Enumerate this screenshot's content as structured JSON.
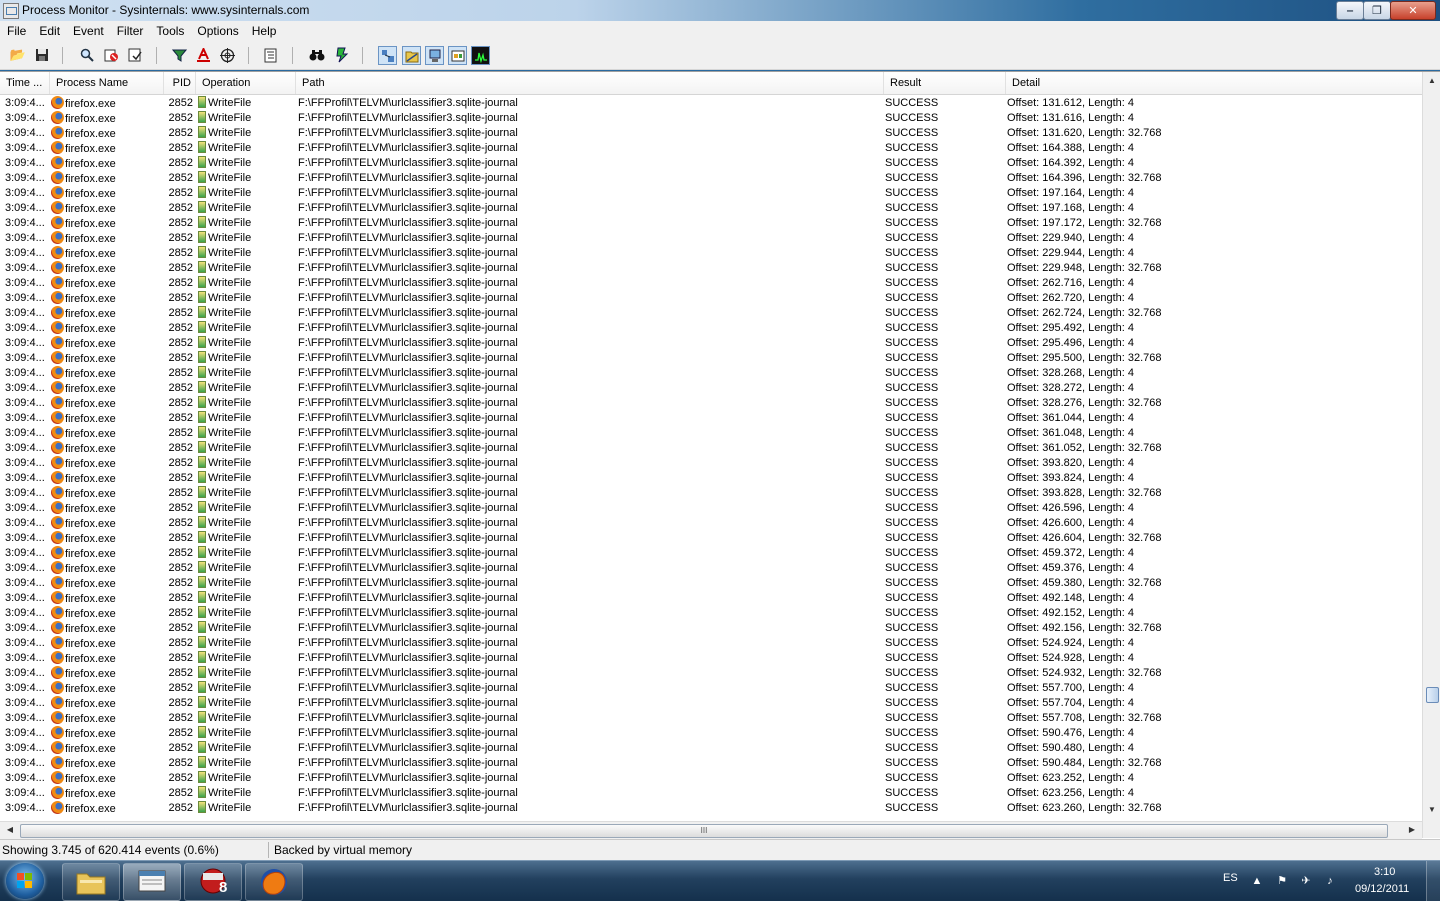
{
  "window": {
    "title": "Process Monitor - Sysinternals: www.sysinternals.com",
    "minimize": "‒",
    "maximize": "❐",
    "close": "✕"
  },
  "menu": [
    "File",
    "Edit",
    "Event",
    "Filter",
    "Tools",
    "Options",
    "Help"
  ],
  "toolbar": {
    "icons": [
      "open-icon",
      "save-icon",
      "magnify-icon",
      "capture-icon",
      "autoscroll-icon",
      "clear-icon",
      "filter-icon",
      "highlight-icon",
      "target-icon",
      "process-tree-icon",
      "find-icon",
      "jump-icon",
      "registry-activity-icon",
      "file-activity-icon",
      "network-activity-icon",
      "process-activity-icon",
      "profiling-icon"
    ]
  },
  "columns": [
    "Time ...",
    "Process Name",
    "PID",
    "Operation",
    "Path",
    "Result",
    "Detail"
  ],
  "row_defaults": {
    "time": "3:09:4...",
    "process": "firefox.exe",
    "pid": "2852",
    "operation": "WriteFile",
    "path": "F:\\FFProfil\\TELVM\\urlclassifier3.sqlite-journal",
    "result": "SUCCESS"
  },
  "details": [
    "Offset: 131.612, Length: 4",
    "Offset: 131.616, Length: 4",
    "Offset: 131.620, Length: 32.768",
    "Offset: 164.388, Length: 4",
    "Offset: 164.392, Length: 4",
    "Offset: 164.396, Length: 32.768",
    "Offset: 197.164, Length: 4",
    "Offset: 197.168, Length: 4",
    "Offset: 197.172, Length: 32.768",
    "Offset: 229.940, Length: 4",
    "Offset: 229.944, Length: 4",
    "Offset: 229.948, Length: 32.768",
    "Offset: 262.716, Length: 4",
    "Offset: 262.720, Length: 4",
    "Offset: 262.724, Length: 32.768",
    "Offset: 295.492, Length: 4",
    "Offset: 295.496, Length: 4",
    "Offset: 295.500, Length: 32.768",
    "Offset: 328.268, Length: 4",
    "Offset: 328.272, Length: 4",
    "Offset: 328.276, Length: 32.768",
    "Offset: 361.044, Length: 4",
    "Offset: 361.048, Length: 4",
    "Offset: 361.052, Length: 32.768",
    "Offset: 393.820, Length: 4",
    "Offset: 393.824, Length: 4",
    "Offset: 393.828, Length: 32.768",
    "Offset: 426.596, Length: 4",
    "Offset: 426.600, Length: 4",
    "Offset: 426.604, Length: 32.768",
    "Offset: 459.372, Length: 4",
    "Offset: 459.376, Length: 4",
    "Offset: 459.380, Length: 32.768",
    "Offset: 492.148, Length: 4",
    "Offset: 492.152, Length: 4",
    "Offset: 492.156, Length: 32.768",
    "Offset: 524.924, Length: 4",
    "Offset: 524.928, Length: 4",
    "Offset: 524.932, Length: 32.768",
    "Offset: 557.700, Length: 4",
    "Offset: 557.704, Length: 4",
    "Offset: 557.708, Length: 32.768",
    "Offset: 590.476, Length: 4",
    "Offset: 590.480, Length: 4",
    "Offset: 590.484, Length: 32.768",
    "Offset: 623.252, Length: 4",
    "Offset: 623.256, Length: 4",
    "Offset: 623.260, Length: 32.768"
  ],
  "scroll_grip": "III",
  "status": {
    "events": "Showing 3.745 of 620.414 events (0.6%)",
    "memory": "Backed by virtual memory"
  },
  "taskbar": {
    "buttons": [
      "explorer-icon",
      "process-monitor-icon",
      "paint-shop-pro-icon",
      "firefox-icon"
    ],
    "psp_label": "8",
    "language": "ES",
    "time": "3:10",
    "date": "09/12/2011"
  },
  "colors": {
    "selection_accent": "#6b94c4",
    "window_bg": "#f0f0f0",
    "taskbar": "#22405e"
  }
}
